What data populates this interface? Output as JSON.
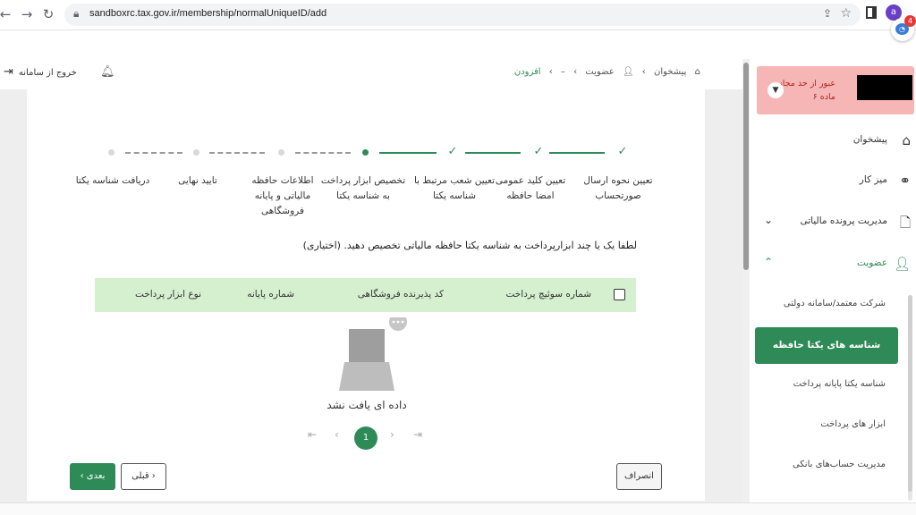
{
  "browser": {
    "url": "sandboxrc.tax.gov.ir/membership/normalUniqueID/add",
    "profile_initial": "a",
    "extension_badge": "4"
  },
  "header": {
    "logout_label": "خروج از سامانه",
    "breadcrumb": [
      "پیشخوان",
      "عضویت",
      "–",
      "افزودن"
    ]
  },
  "stepper": {
    "steps": [
      {
        "label": "تعیین نحوه ارسال صورتحساب",
        "status": "done"
      },
      {
        "label": "تعیین کلید عمومی امضا حافظه",
        "status": "done"
      },
      {
        "label": "تعیین شعب مرتبط با شناسه یکتا",
        "status": "done"
      },
      {
        "label": "تخصیص ابزار پرداخت به شناسه یکتا",
        "status": "current"
      },
      {
        "label": "اطلاعات حافظه مالیاتی و پایانه فروشگاهی",
        "status": "todo"
      },
      {
        "label": "تایید نهایی",
        "status": "todo"
      },
      {
        "label": "دریافت شناسه یکتا",
        "status": "todo"
      }
    ]
  },
  "main": {
    "instruction": "لطفا یک یا چند ابزارپرداخت به شناسه یکتا حافظه مالیاتی تخصیص دهید. (اختیاری)",
    "table_headers": [
      "شماره سوئیچ پرداخت",
      "کد پذیرنده فروشگاهی",
      "شماره پایانه",
      "نوع ابزار پرداخت"
    ],
    "empty_text": "داده ای یافت نشد",
    "current_page": "1"
  },
  "buttons": {
    "next": "بعدی",
    "prev": "قبلی",
    "cancel": "انصراف"
  },
  "sidebar": {
    "alert_line1": "عبور از حد مجاز",
    "alert_line2": "ماده ۶",
    "items": [
      {
        "label": "پیشخوان",
        "icon": "home-icon"
      },
      {
        "label": "میز کار",
        "icon": "workflow-icon"
      },
      {
        "label": "مدیریت پرونده مالیاتی",
        "icon": "file-icon"
      },
      {
        "label": "عضویت",
        "icon": "user-icon"
      }
    ],
    "sub_items": [
      "شرکت معتمد/سامانه دولتی",
      "شناسه های یکتا حافظه مالیاتی",
      "شناسه یکتا پایانه پرداخت",
      "ابزار های پرداخت",
      "مدیریت حساب‌های بانکی"
    ]
  },
  "colors": {
    "accent": "#2e8b57",
    "table_header_bg": "#d4f0cf",
    "alert_bg": "#f6b6b6"
  }
}
